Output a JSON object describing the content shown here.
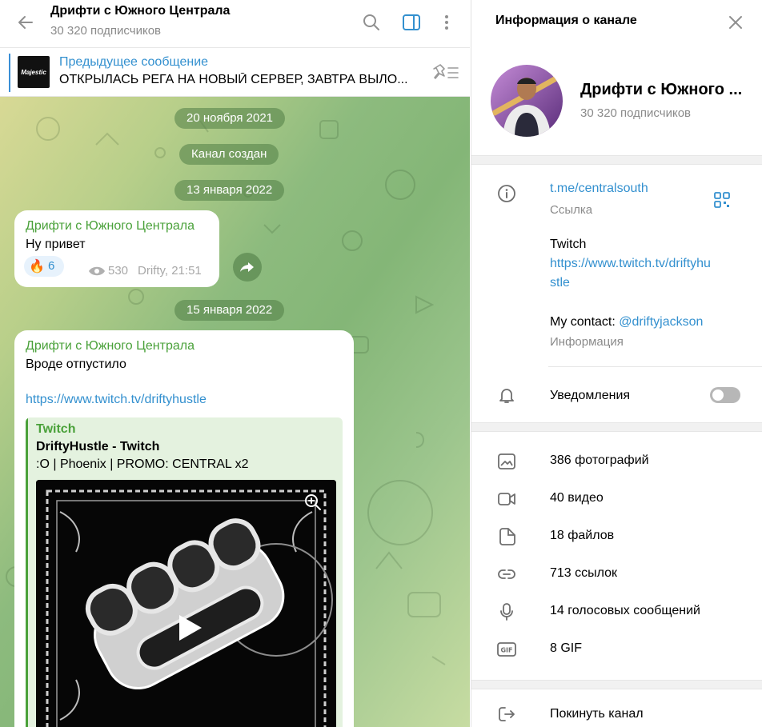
{
  "chat": {
    "title": "Дрифти с Южного Централа",
    "subscribers": "30 320 подписчиков",
    "pinned": {
      "label": "Предыдущее сообщение",
      "text": "ОТКРЫЛАСЬ РЕГА НА НОВЫЙ СЕРВЕР, ЗАВТРА ВЫЛО...",
      "thumb_text": "Majestic"
    },
    "dates": [
      "20 ноября 2021",
      "13 января 2022",
      "15 января 2022"
    ],
    "service_message": "Канал создан",
    "messages": [
      {
        "author": "Дрифти с Южного Централа",
        "text": "Ну привет",
        "reaction": {
          "emoji": "🔥",
          "count": "6"
        },
        "views": "530",
        "signature": "Drifty, 21:51"
      },
      {
        "author": "Дрифти с Южного Централа",
        "text": "Вроде отпустило",
        "link": "https://www.twitch.tv/driftyhustle",
        "preview": {
          "site": "Twitch",
          "title": "DriftyHustle - Twitch",
          "description": ":O | Phoenix | PROMO: CENTRAL x2"
        }
      }
    ]
  },
  "info_panel": {
    "title": "Информация о канале",
    "channel_name": "Дрифти с Южного ...",
    "subscribers": "30 320 подписчиков",
    "link": "t.me/centralsouth",
    "link_caption": "Ссылка",
    "description": {
      "line1": "Twitch",
      "url_line1": "https://www.twitch.tv/driftyhu",
      "url_line2": "stle",
      "contact_prefix": "My contact: ",
      "contact_handle": "@driftyjackson",
      "caption": "Информация"
    },
    "notifications_label": "Уведомления",
    "notifications_enabled": false,
    "media": [
      {
        "icon": "photo-icon",
        "label": "386 фотографий"
      },
      {
        "icon": "video-icon",
        "label": "40 видео"
      },
      {
        "icon": "file-icon",
        "label": "18 файлов"
      },
      {
        "icon": "link-icon",
        "label": "713 ссылок"
      },
      {
        "icon": "microphone-icon",
        "label": "14 голосовых сообщений"
      },
      {
        "icon": "gif-icon",
        "label": "8 GIF"
      }
    ],
    "leave_label": "Покинуть канал"
  },
  "colors": {
    "accent": "#3390cf",
    "author_green": "#4aa13a",
    "secondary_text": "#8a8a8a"
  }
}
